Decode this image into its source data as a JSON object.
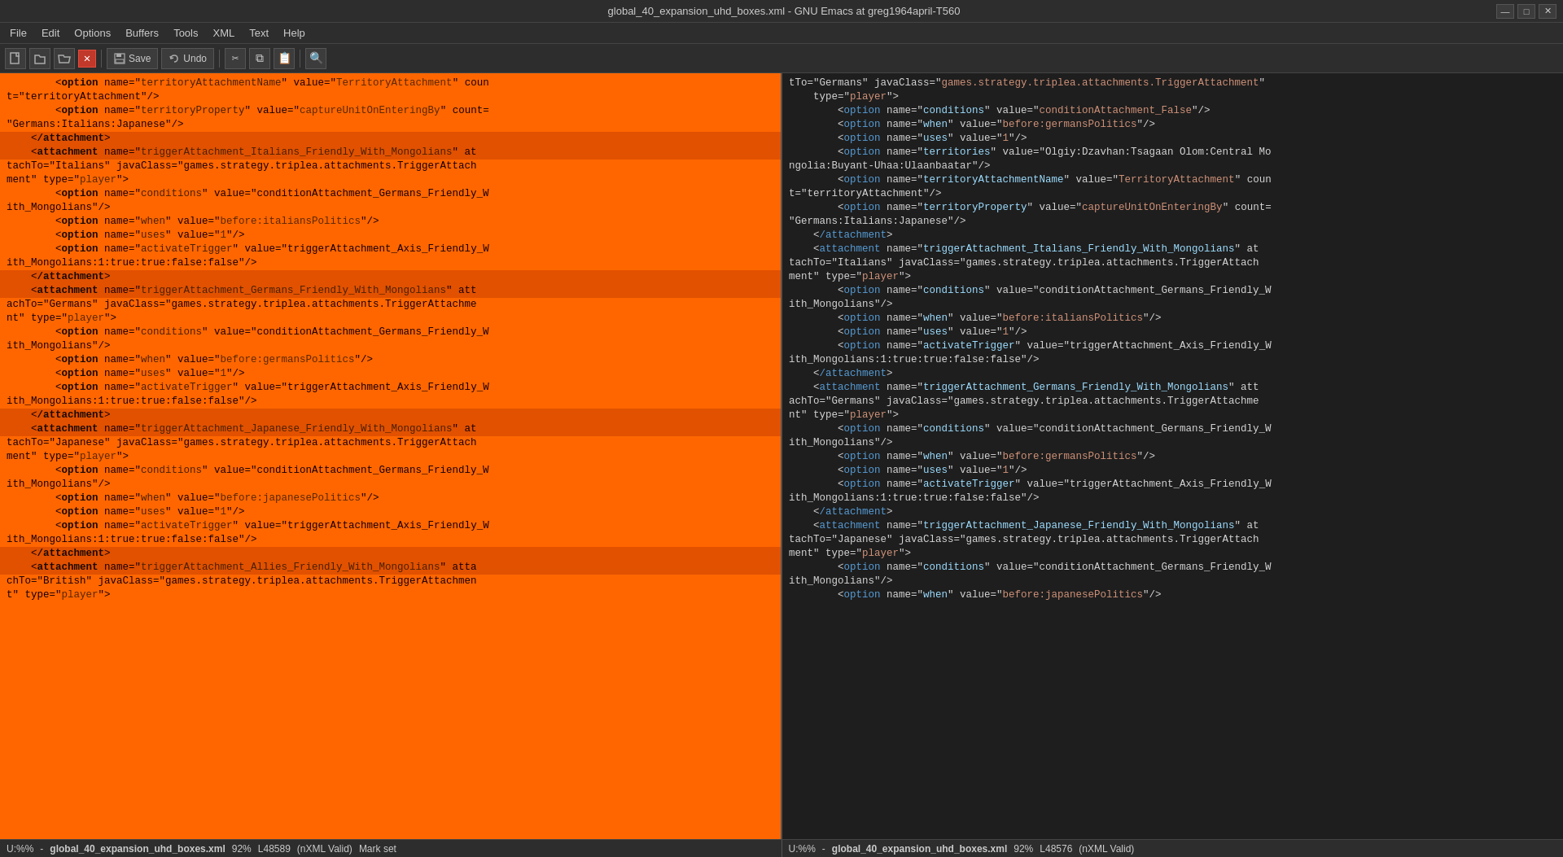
{
  "titleBar": {
    "title": "global_40_expansion_uhd_boxes.xml - GNU Emacs at greg1964april-T560",
    "minimize": "—",
    "maximize": "□",
    "close": "✕"
  },
  "menuBar": {
    "items": [
      "File",
      "Edit",
      "Options",
      "Buffers",
      "Tools",
      "XML",
      "Text",
      "Help"
    ]
  },
  "toolbar": {
    "save_label": "Save",
    "undo_label": "Undo",
    "search_icon": "🔍"
  },
  "leftPane": {
    "lines": [
      "        <option name=\"territoryAttachmentName\" value=\"TerritoryAttachment\" coun",
      "t=\"territoryAttachment\"/>",
      "        <option name=\"territoryProperty\" value=\"captureUnitOnEnteringBy\" count=",
      "\"Germans:Italians:Japanese\"/>",
      "    </attachment>",
      "    <attachment name=\"triggerAttachment_Italians_Friendly_With_Mongolians\" at",
      "tachTo=\"Italians\" javaClass=\"games.strategy.triplea.attachments.TriggerAttach",
      "ment\" type=\"player\">",
      "        <option name=\"conditions\" value=\"conditionAttachment_Germans_Friendly_W",
      "ith_Mongolians\"/>",
      "        <option name=\"when\" value=\"before:italiansPolitics\"/>",
      "        <option name=\"uses\" value=\"1\"/>",
      "        <option name=\"activateTrigger\" value=\"triggerAttachment_Axis_Friendly_W",
      "ith_Mongolians:1:true:true:false:false\"/>",
      "    </attachment>",
      "    <attachment name=\"triggerAttachment_Germans_Friendly_With_Mongolians\" att",
      "achTo=\"Germans\" javaClass=\"games.strategy.triplea.attachments.TriggerAttachme",
      "nt\" type=\"player\">",
      "        <option name=\"conditions\" value=\"conditionAttachment_Germans_Friendly_W",
      "ith_Mongolians\"/>",
      "        <option name=\"when\" value=\"before:germansPolitics\"/>",
      "        <option name=\"uses\" value=\"1\"/>",
      "        <option name=\"activateTrigger\" value=\"triggerAttachment_Axis_Friendly_W",
      "ith_Mongolians:1:true:true:false:false\"/>",
      "    </attachment>",
      "    <attachment name=\"triggerAttachment_Japanese_Friendly_With_Mongolians\" at",
      "tachTo=\"Japanese\" javaClass=\"games.strategy.triplea.attachments.TriggerAttach",
      "ment\" type=\"player\">",
      "        <option name=\"conditions\" value=\"conditionAttachment_Germans_Friendly_W",
      "ith_Mongolians\"/>",
      "        <option name=\"when\" value=\"before:japanesePolitics\"/>",
      "        <option name=\"uses\" value=\"1\"/>",
      "        <option name=\"activateTrigger\" value=\"triggerAttachment_Axis_Friendly_W",
      "ith_Mongolians:1:true:true:false:false\"/>",
      "    </attachment>",
      "    <attachment name=\"triggerAttachment_Allies_Friendly_With_Mongolians\" atta",
      "chTo=\"British\" javaClass=\"games.strategy.triplea.attachments.TriggerAttachmen",
      "t\" type=\"player\">"
    ]
  },
  "rightPane": {
    "lines": [
      "tTo=\"Germans\" javaClass=\"games.strategy.triplea.attachments.TriggerAttachment\"",
      "    type=\"player\">",
      "        <option name=\"conditions\" value=\"conditionAttachment_False\"/>",
      "        <option name=\"when\" value=\"before:germansPolitics\"/>",
      "        <option name=\"uses\" value=\"1\"/>",
      "        <option name=\"territories\" value=\"Olgiy:Dzavhan:Tsagaan Olom:Central Mo",
      "ngolia:Buyant-Uhaa:Ulaanbaatar\"/>",
      "        <option name=\"territoryAttachmentName\" value=\"TerritoryAttachment\" coun",
      "t=\"territoryAttachment\"/>",
      "        <option name=\"territoryProperty\" value=\"captureUnitOnEnteringBy\" count=",
      "\"Germans:Italians:Japanese\"/>",
      "    </attachment>",
      "    <attachment name=\"triggerAttachment_Italians_Friendly_With_Mongolians\" at",
      "tachTo=\"Italians\" javaClass=\"games.strategy.triplea.attachments.TriggerAttach",
      "ment\" type=\"player\">",
      "        <option name=\"conditions\" value=\"conditionAttachment_Germans_Friendly_W",
      "ith_Mongolians\"/>",
      "        <option name=\"when\" value=\"before:italiansPolitics\"/>",
      "        <option name=\"uses\" value=\"1\"/>",
      "        <option name=\"activateTrigger\" value=\"triggerAttachment_Axis_Friendly_W",
      "ith_Mongolians:1:true:true:false:false\"/>",
      "    </attachment>",
      "    <attachment name=\"triggerAttachment_Germans_Friendly_With_Mongolians\" att",
      "achTo=\"Germans\" javaClass=\"games.strategy.triplea.attachments.TriggerAttachme",
      "nt\" type=\"player\">",
      "        <option name=\"conditions\" value=\"conditionAttachment_Germans_Friendly_W",
      "ith_Mongolians\"/>",
      "        <option name=\"when\" value=\"before:germansPolitics\"/>",
      "        <option name=\"uses\" value=\"1\"/>",
      "        <option name=\"activateTrigger\" value=\"triggerAttachment_Axis_Friendly_W",
      "ith_Mongolians:1:true:true:false:false\"/>",
      "    </attachment>",
      "    <attachment name=\"triggerAttachment_Japanese_Friendly_With_Mongolians\" at",
      "tachTo=\"Japanese\" javaClass=\"games.strategy.triplea.attachments.TriggerAttach",
      "ment\" type=\"player\">",
      "        <option name=\"conditions\" value=\"conditionAttachment_Germans_Friendly_W",
      "ith_Mongolians\"/>",
      "        <option name=\"when\" value=\"before:japanesePolitics\"/>"
    ]
  },
  "statusBar": {
    "left": {
      "mode": "U:%%",
      "separator": "-",
      "filename": "global_40_expansion_uhd_boxes.xml",
      "percent": "92%",
      "line": "L48589",
      "extra": "(nXML Valid)",
      "mark": "Mark set"
    },
    "right": {
      "mode": "U:%%",
      "separator": "-",
      "filename": "global_40_expansion_uhd_boxes.xml",
      "percent": "92%",
      "line": "L48576",
      "extra": "(nXML Valid)"
    }
  }
}
